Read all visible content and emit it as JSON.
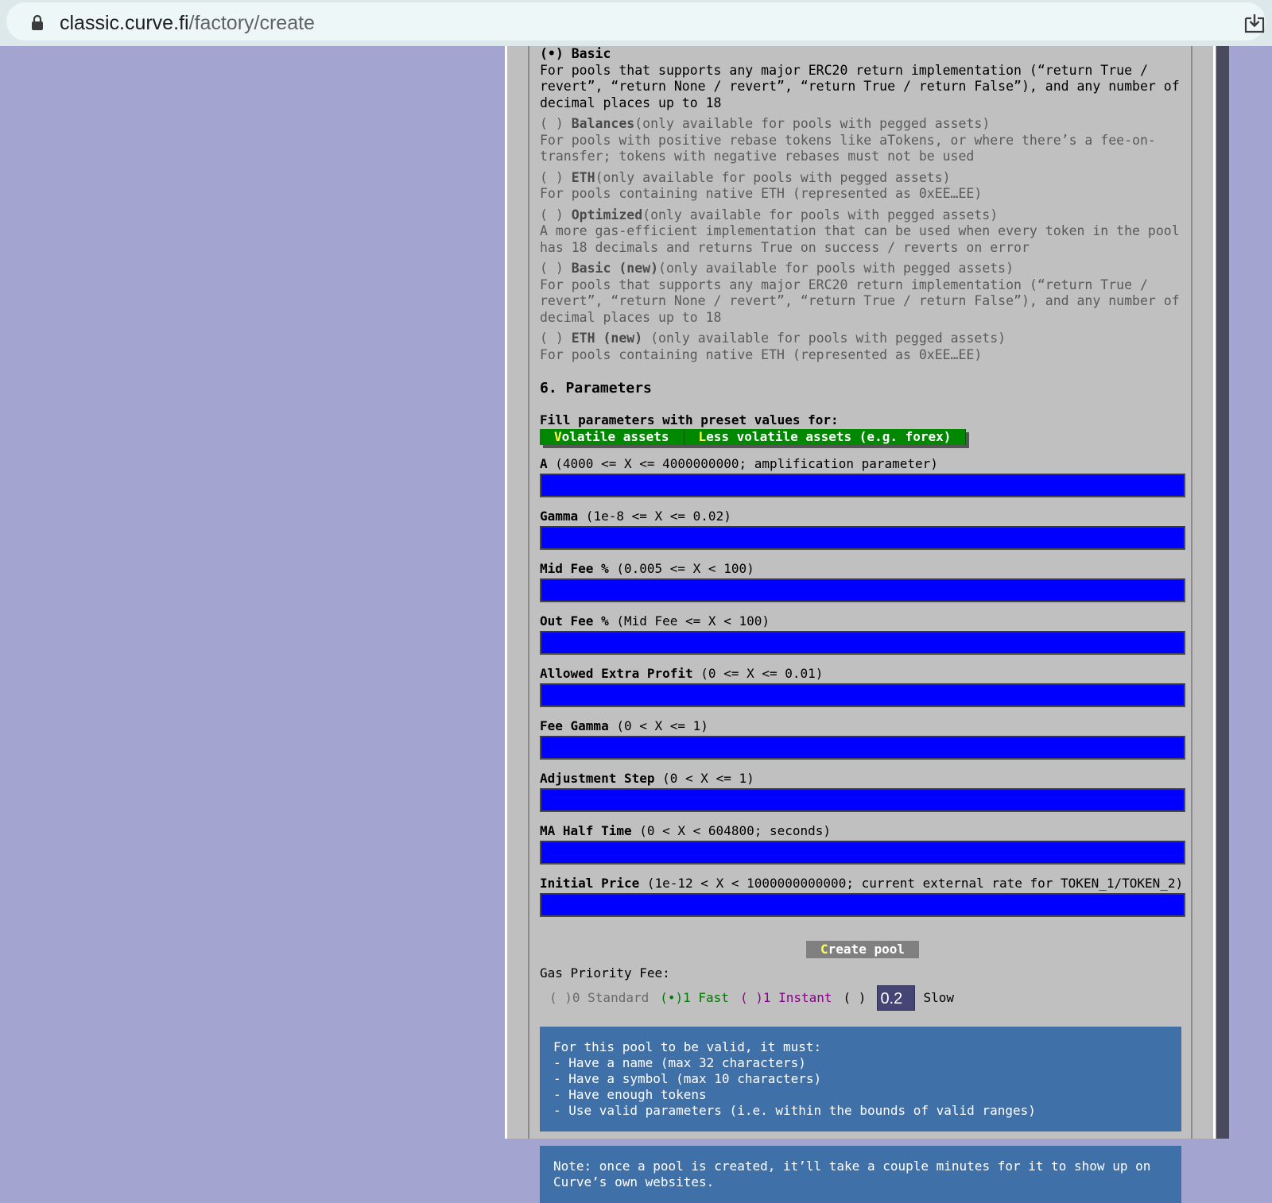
{
  "browser": {
    "url_host": "classic.curve.fi",
    "url_path": "/factory/create"
  },
  "implementations": [
    {
      "radio": "(•)",
      "name": "Basic",
      "note": "",
      "desc": "For pools that supports any major ERC20 return implementation (“return True / revert”, “return None / revert”, “return True / return False”), and any number of decimal places up to 18",
      "selected": true
    },
    {
      "radio": "( )",
      "name": "Balances",
      "note": "(only available for pools with pegged assets)",
      "desc": "For pools with positive rebase tokens like aTokens, or where there’s a fee-on-transfer; tokens with negative rebases must not be used",
      "selected": false
    },
    {
      "radio": "( )",
      "name": "ETH",
      "note": "(only available for pools with pegged assets)",
      "desc": "For pools containing native ETH (represented as 0xEE…EE)",
      "selected": false
    },
    {
      "radio": "( )",
      "name": "Optimized",
      "note": "(only available for pools with pegged assets)",
      "desc": "A more gas-efficient implementation that can be used when every token in the pool has 18 decimals and returns True on success / reverts on error",
      "selected": false
    },
    {
      "radio": "( )",
      "name": "Basic (new)",
      "note": "(only available for pools with pegged assets)",
      "desc": "For pools that supports any major ERC20 return implementation (“return True / revert”, “return None / revert”, “return True / return False”), and any number of decimal places up to 18",
      "selected": false
    },
    {
      "radio": "( )",
      "name": "ETH (new)",
      "note": " (only available for pools with pegged assets)",
      "desc": "For pools containing native ETH (represented as 0xEE…EE)",
      "selected": false
    }
  ],
  "parameters": {
    "heading": "6. Parameters",
    "fill_label": "Fill parameters with preset values for:",
    "presets": [
      {
        "hotkey": "V",
        "rest": "olatile assets"
      },
      {
        "hotkey": "L",
        "rest": "ess volatile assets (e.g. forex)"
      }
    ],
    "fields": [
      {
        "name": "A",
        "range": " (4000 <= X <= 4000000000; amplification parameter)",
        "value": ""
      },
      {
        "name": "Gamma",
        "range": " (1e-8 <= X <= 0.02)",
        "value": ""
      },
      {
        "name": "Mid Fee %",
        "range": " (0.005 <= X < 100)",
        "value": ""
      },
      {
        "name": "Out Fee %",
        "range": " (Mid Fee <= X < 100)",
        "value": ""
      },
      {
        "name": "Allowed Extra Profit",
        "range": " (0 <= X <= 0.01)",
        "value": ""
      },
      {
        "name": "Fee Gamma",
        "range": " (0 < X <= 1)",
        "value": ""
      },
      {
        "name": "Adjustment Step",
        "range": " (0 < X <= 1)",
        "value": ""
      },
      {
        "name": "MA Half Time",
        "range": " (0 < X < 604800; seconds)",
        "value": ""
      },
      {
        "name": "Initial Price",
        "range": " (1e-12 < X < 1000000000000; current external rate for TOKEN_1/TOKEN_2)",
        "value": ""
      }
    ]
  },
  "create": {
    "hotkey": "C",
    "rest": "reate pool"
  },
  "gas": {
    "label": "Gas Priority Fee:",
    "standard": "( )0 Standard",
    "fast": "(•)1 Fast",
    "instant": "( )1 Instant",
    "custom_radio": "( )",
    "custom_value": "0.2",
    "slow": "Slow"
  },
  "validity": {
    "lines": [
      "For this pool to be valid, it must:",
      "- Have a name (max 32 characters)",
      "- Have a symbol (max 10 characters)",
      "- Have enough tokens",
      "- Use valid parameters (i.e. within the bounds of valid ranges)"
    ]
  },
  "note": "Note: once a pool is created, it’ll take a couple minutes for it to show up on Curve’s own websites.",
  "colors": {
    "page_bg": "#a4a4d0",
    "panel_bg": "#c0c0c0",
    "input_bg": "#0000ff",
    "preset_btn": "#008800",
    "info_box": "#4070a8"
  }
}
